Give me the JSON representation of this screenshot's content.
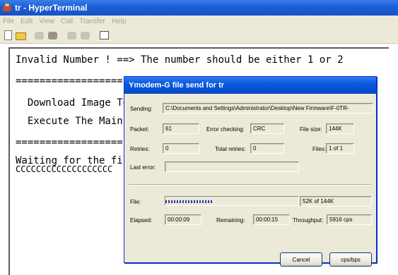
{
  "window": {
    "title": "tr - HyperTerminal",
    "menu": [
      "File",
      "Edit",
      "View",
      "Call",
      "Transfer",
      "Help"
    ]
  },
  "toolbar": {
    "icons": [
      "new-icon",
      "open-icon",
      "disconnect-icon",
      "call-icon",
      "send-icon",
      "receive-icon",
      "properties-icon"
    ]
  },
  "terminal": {
    "lines": [
      "Invalid Number ! ==> The number should be either 1 or 2",
      "==================",
      "  Download Image To",
      "  Execute The Main",
      "==================",
      "Waiting for the fil",
      "CCCCCCCCCCCCCCCCCCC"
    ]
  },
  "dialog": {
    "title": "Ymodem-G file send for tr",
    "sending_label": "Sending:",
    "sending_value": "C:\\Documents and Settings\\Administrator\\Desktop\\New Firmware\\F-0TR-",
    "packet_label": "Packet:",
    "packet_value": "61",
    "error_checking_label": "Error checking:",
    "error_checking_value": "CRC",
    "file_size_label": "File size:",
    "file_size_value": "144K",
    "retries_label": "Retries:",
    "retries_value": "0",
    "total_retries_label": "Total retries:",
    "total_retries_value": "0",
    "files_label": "Files:",
    "files_value": "1 of 1",
    "last_error_label": "Last error:",
    "last_error_value": "",
    "file_label": "File:",
    "progress_fraction": 0.36,
    "file_progress_value": "52K of 144K",
    "elapsed_label": "Elapsed:",
    "elapsed_value": "00:00:09",
    "remaining_label": "Remaining:",
    "remaining_value": "00:00:15",
    "throughput_label": "Throughput:",
    "throughput_value": "5916 cps",
    "cancel_label": "Cancel",
    "cps_label": "cps/bps"
  },
  "colors": {
    "titlebar": "#1c5fd6",
    "progress": "#2a3fae",
    "dialog_bg": "#ece9d8"
  }
}
